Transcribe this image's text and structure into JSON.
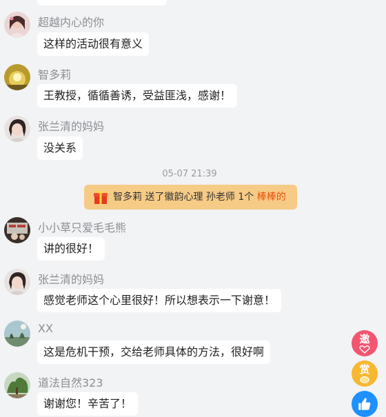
{
  "messages": [
    {
      "name": "超越内心的你",
      "text": "这样的活动很有意义"
    },
    {
      "name": "智多莉",
      "text": "王教授，循循善诱，受益匪浅，感谢！"
    },
    {
      "name": "张兰清的妈妈",
      "text": "没关系"
    },
    {
      "name": "小小草只爱毛毛熊",
      "text": "讲的很好！"
    },
    {
      "name": "张兰清的妈妈",
      "text": "感觉老师这个心里很好！所以想表示一下谢意！"
    },
    {
      "name": "XX",
      "text": "这是危机干预，交给老师具体的方法，很好啊"
    },
    {
      "name": "道法自然323",
      "text": "谢谢您！辛苦了！"
    }
  ],
  "timestamp": "05-07 21:39",
  "gift": {
    "text": "智多莉 送了徽韵心理 孙老师 1个 ",
    "item": "棒棒的",
    "icon": "gift-box-icon"
  },
  "side_buttons": {
    "invite": {
      "label": "邀",
      "icon": "heart-icon",
      "color": "#f2556f"
    },
    "reward": {
      "label": "赏",
      "icon": "coin-icon",
      "color": "#f7b731"
    },
    "like": {
      "icon": "thumbs-up-icon",
      "color": "#1e90ff"
    }
  }
}
